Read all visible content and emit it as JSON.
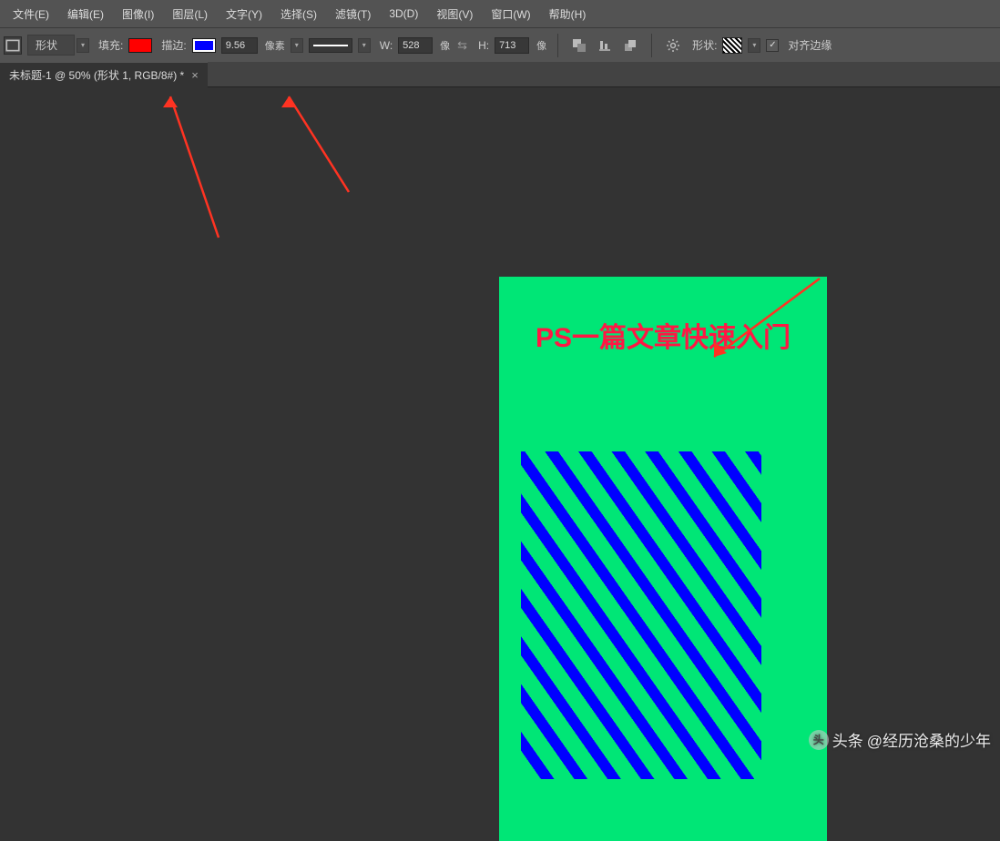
{
  "menu": {
    "file": "文件(E)",
    "edit": "编辑(E)",
    "image": "图像(I)",
    "layer": "图层(L)",
    "type": "文字(Y)",
    "select": "选择(S)",
    "filter": "滤镜(T)",
    "threeD": "3D(D)",
    "view": "视图(V)",
    "window": "窗口(W)",
    "help": "帮助(H)"
  },
  "options": {
    "shape_label": "形状",
    "fill_label": "填充:",
    "fill_color": "#ff0000",
    "stroke_label": "描边:",
    "stroke_color": "#0000ff",
    "stroke_width": "9.56",
    "px_unit": "像素",
    "w_label": "W:",
    "w_value": "528",
    "w_unit": "像",
    "h_label": "H:",
    "h_value": "713",
    "h_unit": "像",
    "shape2_label": "形状:",
    "align_label": "对齐边缘"
  },
  "tab": {
    "title": "未标题-1 @ 50% (形状 1, RGB/8#) *"
  },
  "document": {
    "title": "PS一篇文章快速入门"
  },
  "watermark": {
    "prefix": "头条",
    "handle": "@经历沧桑的少年"
  }
}
